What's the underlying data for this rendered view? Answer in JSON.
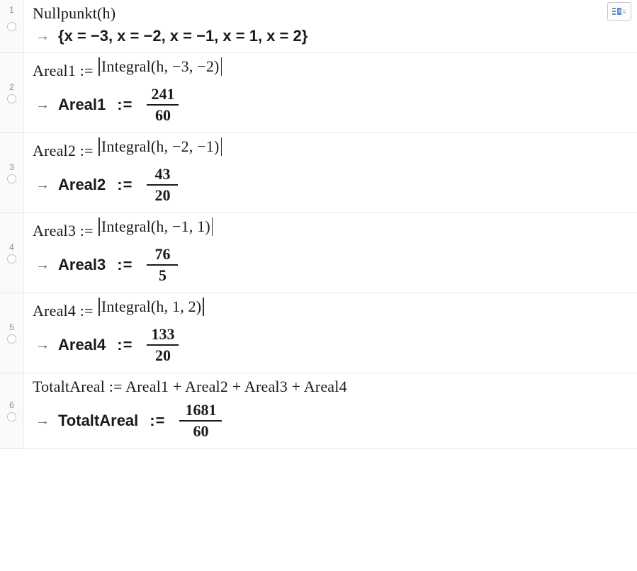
{
  "toolbar": {
    "symbol_x": "x",
    "symbol_eq": "="
  },
  "rows": [
    {
      "index": "1",
      "input": "Nullpunkt(h)",
      "output_set": "{x = −3, x = −2, x = −1, x = 1, x = 2}"
    },
    {
      "index": "2",
      "input_prefix": "Areal1 := ",
      "input_abs": "Integral(h, −3, −2)",
      "output_label": "Areal1",
      "output_assign": ":=",
      "output_num": "241",
      "output_den": "60"
    },
    {
      "index": "3",
      "input_prefix": "Areal2 := ",
      "input_abs": "Integral(h, −2, −1)",
      "output_label": "Areal2",
      "output_assign": ":=",
      "output_num": "43",
      "output_den": "20"
    },
    {
      "index": "4",
      "input_prefix": "Areal3 := ",
      "input_abs": "Integral(h, −1, 1)",
      "output_label": "Areal3",
      "output_assign": ":=",
      "output_num": "76",
      "output_den": "5"
    },
    {
      "index": "5",
      "input_prefix": "Areal4 := ",
      "input_abs": "Integral(h, 1, 2)",
      "output_label": "Areal4",
      "output_assign": ":=",
      "output_num": "133",
      "output_den": "20"
    },
    {
      "index": "6",
      "input_full": "TotaltAreal :=  Areal1 + Areal2 + Areal3 + Areal4",
      "output_label": "TotaltAreal",
      "output_assign": ":=",
      "output_num": "1681",
      "output_den": "60"
    }
  ]
}
